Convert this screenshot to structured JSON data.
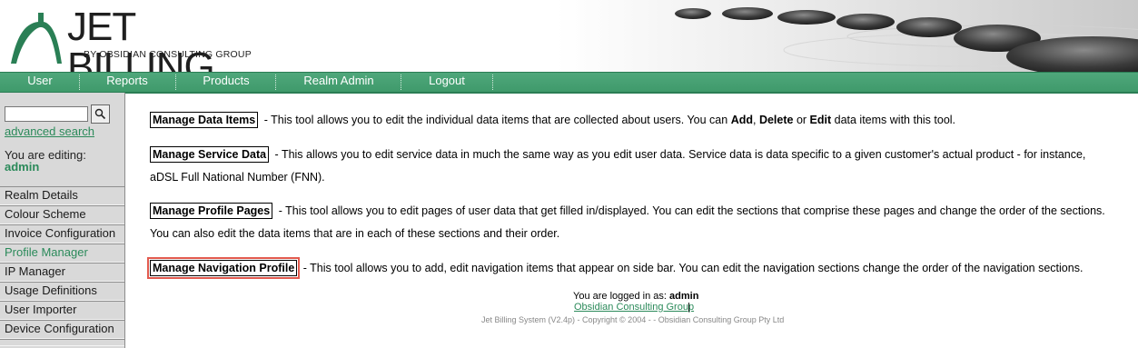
{
  "header": {
    "logo_title": "JET BILLING",
    "logo_subtitle": "BY OBSIDIAN CONSULTING GROUP"
  },
  "nav": {
    "items": [
      {
        "label": "User"
      },
      {
        "label": "Reports"
      },
      {
        "label": "Products"
      },
      {
        "label": "Realm Admin"
      },
      {
        "label": "Logout"
      }
    ]
  },
  "sidebar": {
    "search_value": "",
    "advanced_search": "advanced search",
    "editing_label": "You are editing:",
    "editing_user": "admin",
    "items": [
      {
        "label": "Realm Details"
      },
      {
        "label": "Colour Scheme"
      },
      {
        "label": "Invoice Configuration"
      },
      {
        "label": "Profile Manager"
      },
      {
        "label": "IP Manager"
      },
      {
        "label": "Usage Definitions"
      },
      {
        "label": "User Importer"
      },
      {
        "label": "Device Configuration"
      }
    ]
  },
  "main": {
    "tools": [
      {
        "button": "Manage Data Items",
        "text_a": " - This tool allows you to edit the individual data items that are collected about users. You can ",
        "b1": "Add",
        "t1": ", ",
        "b2": "Delete",
        "t2": " or ",
        "b3": "Edit",
        "t3": " data items with this tool."
      },
      {
        "button": "Manage Service Data",
        "text": " - This allows you to edit service data in much the same way as you edit user data. Service data is data specific to a given customer's actual product - for instance, aDSL Full National Number (FNN)."
      },
      {
        "button": "Manage Profile Pages",
        "text": " - This tool allows you to edit pages of user data that get filled in/displayed. You can edit the sections that comprise these pages and change the order of the sections. You can also edit the data items that are in each of these sections and their order."
      },
      {
        "button": "Manage Navigation Profile",
        "text": " - This tool allows you to add, edit navigation items that appear on side bar. You can edit the navigation sections change the order of the navigation sections."
      }
    ]
  },
  "footer": {
    "logged_in_label": "You are logged in as: ",
    "logged_in_user": "admin",
    "company_link": "Obsidian Consulting Group",
    "separator": "|",
    "copyright": "Jet Billing System (V2.4p) - Copyright © 2004 - - Obsidian Consulting Group Pty Ltd"
  },
  "colors": {
    "nav_green": "#3f9a6b",
    "link_green": "#2b8a5a",
    "highlight_red": "#e25a4e",
    "sidebar_gray": "#d9d9d9"
  }
}
